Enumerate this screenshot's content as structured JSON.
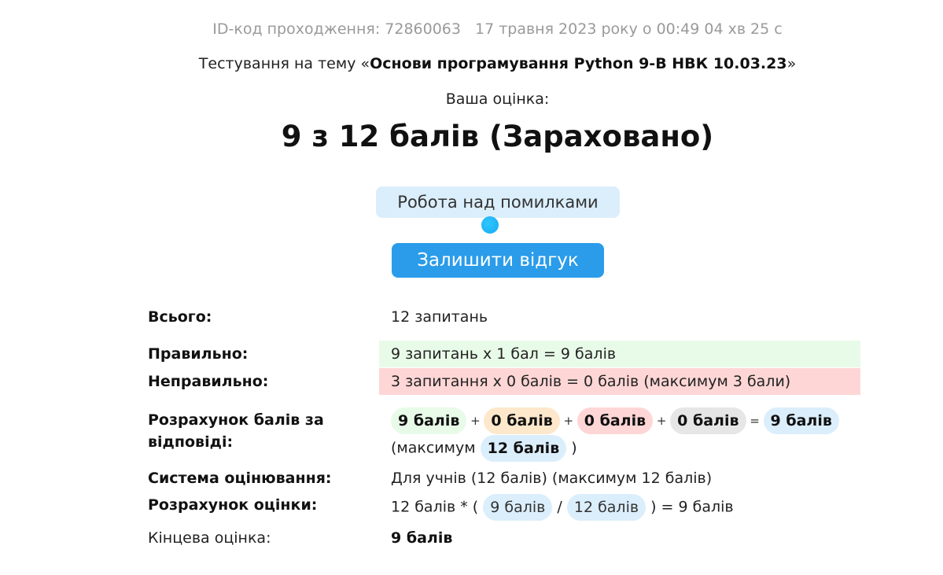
{
  "header": {
    "attempt_id": "ID-код проходження: 72860063",
    "datetime": "17 травня 2023 року о 00:49 04 хв 25 с",
    "subject_prefix": "Тестування на тему «",
    "subject_title": "Основи програмування Python 9-В НВК 10.03.23",
    "subject_suffix": "»",
    "your_grade_label": "Ваша оцінка:",
    "score_text": "9 з 12 балів (Зараховано)"
  },
  "actions": {
    "work_on_mistakes": "Робота над помилками",
    "leave_feedback": "Залишити відгук"
  },
  "summary": {
    "total_label": "Всього:",
    "total_value": "12 запитань",
    "correct_label": "Правильно:",
    "correct_value": "9 запитань x 1 бал = 9 балів",
    "incorrect_label": "Неправильно:",
    "incorrect_value": "3 запитання x 0 балів = 0 балів (максимум 3 бали)",
    "calc_label_1": "Розрахунок балів за",
    "calc_label_2": "відповіді:",
    "pill_correct": "9 балів",
    "pill_partial": "0 балів",
    "pill_wrong": "0 балів",
    "pill_skipped": "0 балів",
    "pill_total": "9 балів",
    "op_plus": "+",
    "op_eq": "=",
    "max_prefix": "(максимум",
    "max_pill": "12 балів",
    "max_suffix": ")",
    "system_label": "Система оцінювання:",
    "system_value": "Для учнів (12 балів) (максимум 12 балів)",
    "grade_calc_label": "Розрахунок оцінки:",
    "grade_calc_prefix": "12 балів * (",
    "grade_calc_pill_a": "9 балів",
    "grade_calc_slash": "/",
    "grade_calc_pill_b": "12 балів",
    "grade_calc_suffix": ") = 9 балів",
    "final_label": "Кінцева оцінка:",
    "final_value": "9 балів"
  },
  "colors": {
    "primary_button": "#2a9cea",
    "secondary_button_bg": "#dbeefb",
    "correct_bg": "#e8fbe8",
    "incorrect_bg": "#ffd6d6"
  }
}
